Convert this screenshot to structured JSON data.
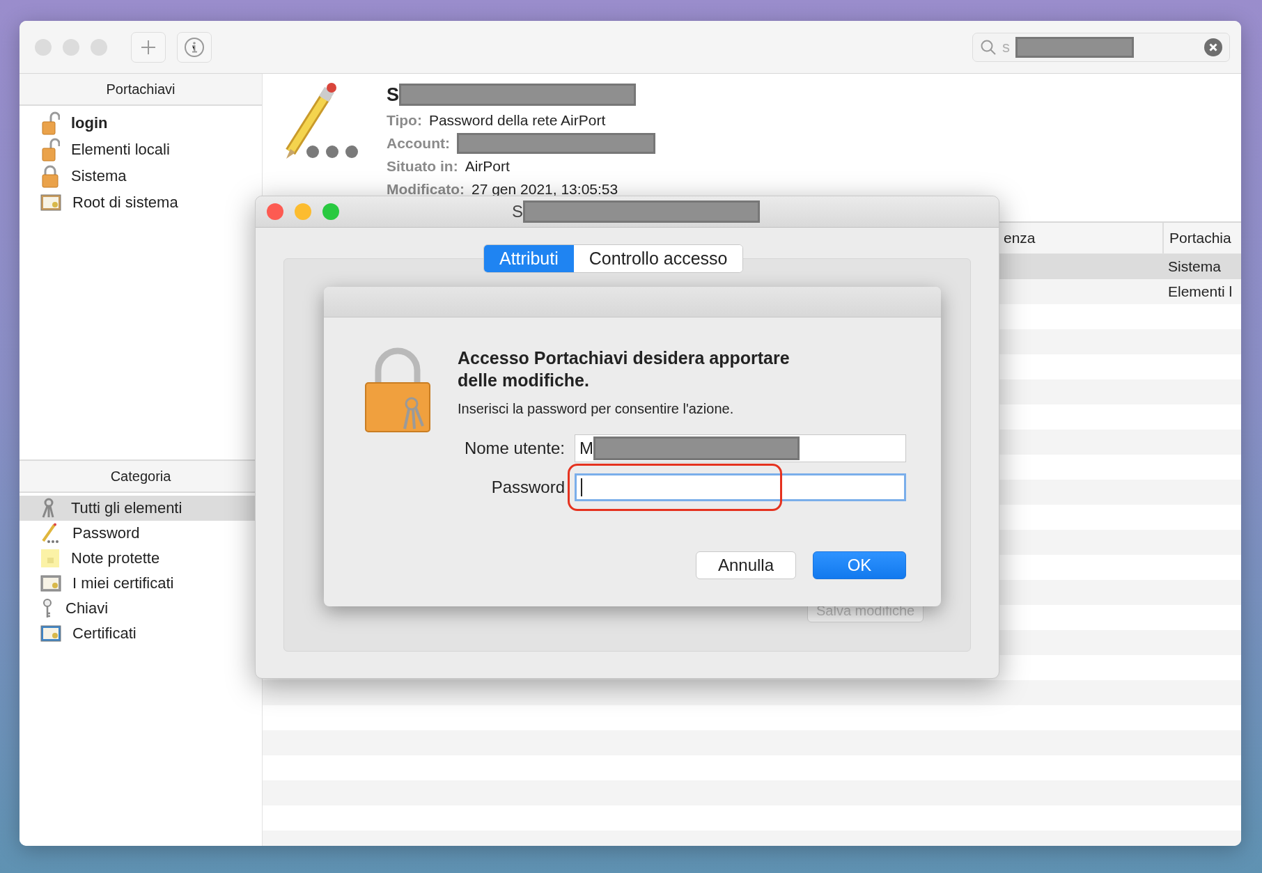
{
  "search": {
    "value": "s",
    "redacted": true
  },
  "sidebar": {
    "keychains_header": "Portachiavi",
    "keychains": [
      {
        "label": "login",
        "kind": "unlocked",
        "default": true,
        "selected": false
      },
      {
        "label": "Elementi locali",
        "kind": "unlocked",
        "default": false,
        "selected": false
      },
      {
        "label": "Sistema",
        "kind": "locked",
        "default": false,
        "selected": false
      },
      {
        "label": "Root di sistema",
        "kind": "certificates",
        "default": false,
        "selected": false
      }
    ],
    "category_header": "Categoria",
    "categories": [
      {
        "label": "Tutti gli elementi",
        "kind": "keys",
        "selected": true
      },
      {
        "label": "Password",
        "kind": "password",
        "selected": false
      },
      {
        "label": "Note protette",
        "kind": "note",
        "selected": false
      },
      {
        "label": "I miei certificati",
        "kind": "my-certificate",
        "selected": false
      },
      {
        "label": "Chiavi",
        "kind": "key",
        "selected": false
      },
      {
        "label": "Certificati",
        "kind": "certificate",
        "selected": false
      }
    ]
  },
  "detail": {
    "name": "S",
    "name_redacted": true,
    "fields": [
      {
        "label": "Tipo:",
        "value": "Password della rete AirPort"
      },
      {
        "label": "Account:",
        "redacted": true
      },
      {
        "label": "Situato in:",
        "value": "AirPort"
      },
      {
        "label": "Modificato:",
        "value": "27 gen 2021, 13:05:53"
      }
    ]
  },
  "table": {
    "columns": [
      {
        "label": "enza"
      },
      {
        "label": "Portachia"
      }
    ],
    "rows": [
      {
        "keychain": "Sistema",
        "selected": true
      },
      {
        "keychain": "Elementi l",
        "selected": false
      }
    ]
  },
  "attributes_window": {
    "title": "S",
    "title_redacted": true,
    "tabs": [
      {
        "label": "Attributi",
        "selected": true
      },
      {
        "label": "Controllo accesso",
        "selected": false
      }
    ],
    "save_button": {
      "label": "Salva modifiche",
      "disabled": true
    }
  },
  "auth_sheet": {
    "heading": "Accesso Portachiavi desidera apportare delle modifiche.",
    "message": "Inserisci la password per consentire l'azione.",
    "fields": [
      {
        "label": "Nome utente:",
        "value": "M",
        "redacted": true,
        "focused": false
      },
      {
        "label": "Password",
        "focused": true,
        "highlighted": true
      }
    ],
    "buttons": [
      {
        "label": "Annulla",
        "kind": "secondary"
      },
      {
        "label": "OK",
        "kind": "primary"
      }
    ]
  }
}
